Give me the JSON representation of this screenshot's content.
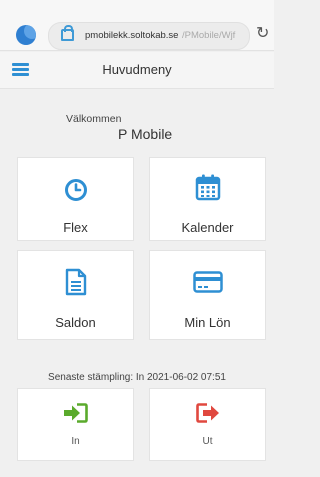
{
  "browser": {
    "url_host": "pmobilekk.soltokab.se",
    "url_path": "/PMobile/Wjf"
  },
  "header": {
    "title": "Huvudmeny"
  },
  "welcome": {
    "greeting": "Välkommen",
    "name": "P Mobile"
  },
  "tiles": [
    {
      "label": "Flex",
      "icon": "clock-icon",
      "color": "#2e8fd3"
    },
    {
      "label": "Kalender",
      "icon": "calendar-icon",
      "color": "#2e8fd3"
    },
    {
      "label": "Saldon",
      "icon": "document-icon",
      "color": "#2e8fd3"
    },
    {
      "label": "Min Lön",
      "icon": "credit-card-icon",
      "color": "#2e8fd3"
    }
  ],
  "last_stamp": {
    "text": "Senaste stämpling: In 2021-06-02 07:51"
  },
  "stamp_buttons": [
    {
      "label": "In",
      "icon": "sign-in-icon",
      "color": "#5aaa2c"
    },
    {
      "label": "Ut",
      "icon": "sign-out-icon",
      "color": "#e0483f"
    }
  ]
}
